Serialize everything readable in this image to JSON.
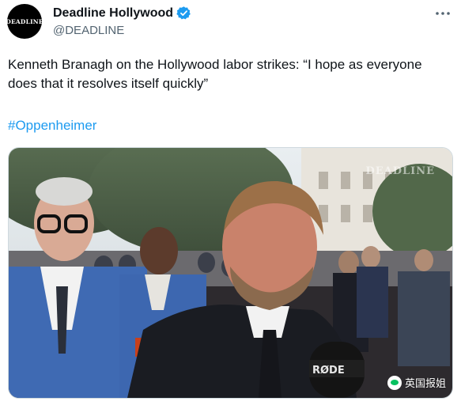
{
  "author": {
    "display_name": "Deadline Hollywood",
    "handle": "@DEADLINE",
    "avatar_text": "DEADLINE",
    "verified": true,
    "verified_color": "#1d9bf0"
  },
  "tweet": {
    "text": "Kenneth Branagh on the Hollywood labor strikes: “I hope as everyone does that it resolves itself quickly”",
    "hashtag": "#Oppenheimer",
    "link_color": "#1d9bf0"
  },
  "media": {
    "watermark_brand": "DEADLINE",
    "mic_brand": "RØDE",
    "source_watermark": "英国报姐"
  },
  "icons": {
    "more": "more-horizontal-icon",
    "verified": "verified-badge-icon",
    "watermark": "wechat-icon"
  }
}
